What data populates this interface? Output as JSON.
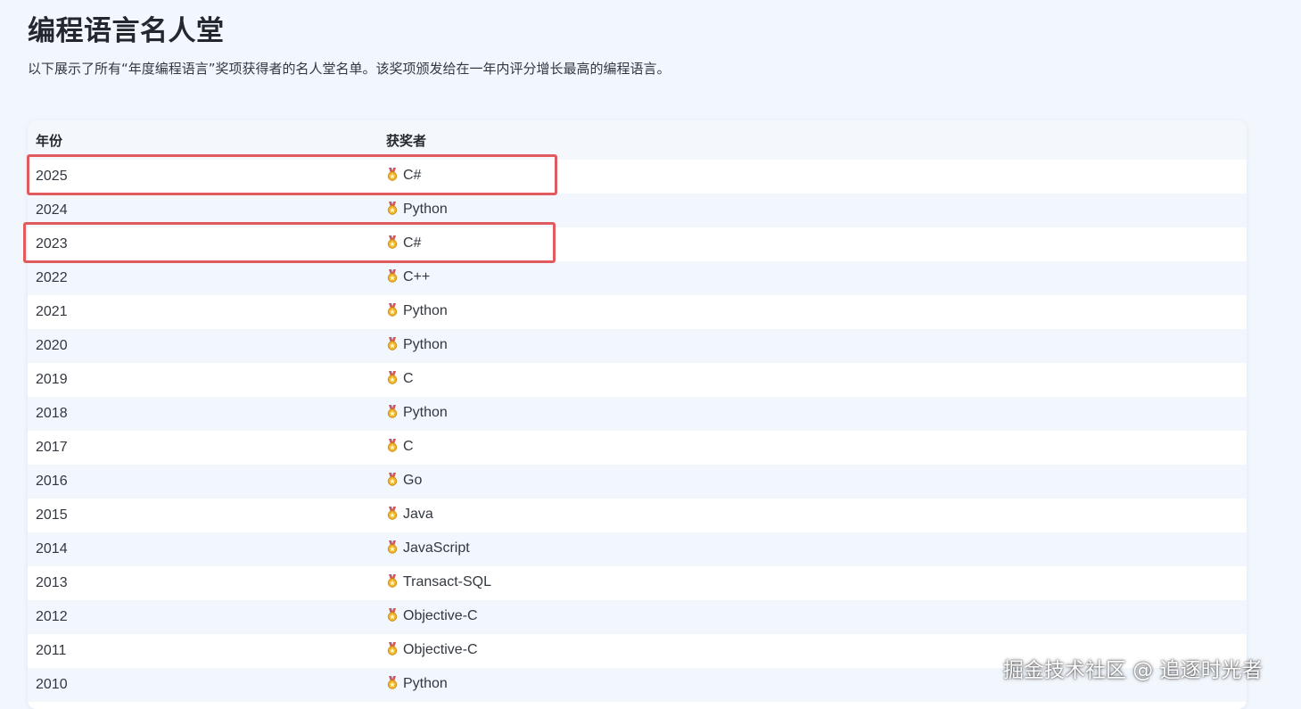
{
  "header": {
    "title": "编程语言名人堂",
    "description": "以下展示了所有“年度编程语言”奖项获得者的名人堂名单。该奖项颁发给在一年内评分增长最高的编程语言。"
  },
  "table": {
    "columns": [
      "年份",
      "获奖者"
    ],
    "rows": [
      {
        "year": "2025",
        "winner": "C#"
      },
      {
        "year": "2024",
        "winner": "Python"
      },
      {
        "year": "2023",
        "winner": "C#"
      },
      {
        "year": "2022",
        "winner": "C++"
      },
      {
        "year": "2021",
        "winner": "Python"
      },
      {
        "year": "2020",
        "winner": "Python"
      },
      {
        "year": "2019",
        "winner": "C"
      },
      {
        "year": "2018",
        "winner": "Python"
      },
      {
        "year": "2017",
        "winner": "C"
      },
      {
        "year": "2016",
        "winner": "Go"
      },
      {
        "year": "2015",
        "winner": "Java"
      },
      {
        "year": "2014",
        "winner": "JavaScript"
      },
      {
        "year": "2013",
        "winner": "Transact-SQL"
      },
      {
        "year": "2012",
        "winner": "Objective-C"
      },
      {
        "year": "2011",
        "winner": "Objective-C"
      },
      {
        "year": "2010",
        "winner": "Python"
      }
    ],
    "highlighted_years": [
      "2025",
      "2023"
    ],
    "row_icon": "medal-icon"
  },
  "watermark": "掘金技术社区 @ 追逐时光者",
  "colors": {
    "background": "#f2f7fd",
    "highlight_border": "#e05a5e",
    "text": "#333840"
  }
}
